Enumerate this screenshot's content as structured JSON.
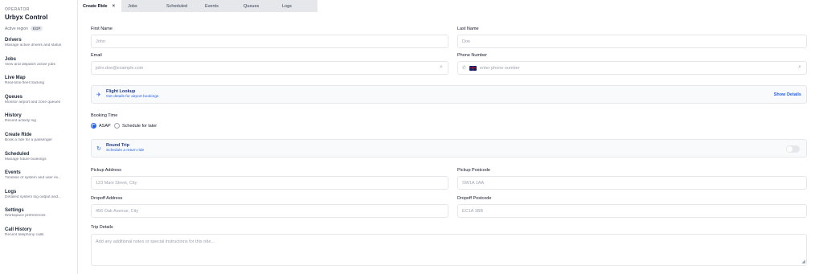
{
  "sidebar": {
    "operator_label": "OPERATOR",
    "app_title": "Urbyx Control",
    "region_label": "Active region",
    "region_badge": "EGP",
    "items": [
      {
        "title": "Drivers",
        "desc": "Manage active drivers and status"
      },
      {
        "title": "Jobs",
        "desc": "View and dispatch active jobs"
      },
      {
        "title": "Live Map",
        "desc": "Real-time fleet tracking"
      },
      {
        "title": "Queues",
        "desc": "Monitor airport and zone queues"
      },
      {
        "title": "History",
        "desc": "Recent activity log"
      },
      {
        "title": "Create Ride",
        "desc": "Book a ride for a passenger"
      },
      {
        "title": "Scheduled",
        "desc": "Manage future bookings"
      },
      {
        "title": "Events",
        "desc": "Timeline of system and user ev..."
      },
      {
        "title": "Logs",
        "desc": "Detailed system log output and..."
      },
      {
        "title": "Settings",
        "desc": "Workspace preferences"
      },
      {
        "title": "Call History",
        "desc": "Recent telephony calls"
      }
    ]
  },
  "tabs": {
    "active": "Create Ride",
    "close": "×",
    "others": [
      "Jobs",
      "Scheduled",
      "Events",
      "Queues",
      "Logs"
    ]
  },
  "form": {
    "first_name": {
      "label": "First Name",
      "placeholder": "John"
    },
    "last_name": {
      "label": "Last Name",
      "placeholder": "Doe"
    },
    "email": {
      "label": "Email",
      "placeholder": "john.doe@example.com"
    },
    "phone": {
      "label": "Phone Number",
      "placeholder": "enter phone number"
    },
    "flight": {
      "title": "Flight Lookup",
      "subtitle": "Get details for airport bookings",
      "action": "Show Details"
    },
    "booking_time": {
      "label": "Booking Time",
      "option_asap": "ASAP",
      "option_later": "Schedule for later",
      "selected": "ASAP"
    },
    "round_trip": {
      "title": "Round Trip",
      "subtitle": "Schedule a return ride",
      "enabled": false
    },
    "pickup_address": {
      "label": "Pickup Address",
      "placeholder": "123 Main Street, City"
    },
    "pickup_postcode": {
      "label": "Pickup Postcode",
      "placeholder": "SW1A 1AA"
    },
    "dropoff_address": {
      "label": "Dropoff Address",
      "placeholder": "456 Oak Avenue, City"
    },
    "dropoff_postcode": {
      "label": "Dropoff Postcode",
      "placeholder": "EC1A 1BB"
    },
    "trip_details": {
      "label": "Trip Details",
      "placeholder": "Add any additional notes or special instructions for this ride..."
    }
  },
  "colors": {
    "accent": "#2563eb",
    "tab_bar": "#e5e7eb",
    "border": "#e5e7eb"
  },
  "icons": {
    "search": "search-icon",
    "phone": "phone-icon",
    "plane": "plane-icon",
    "refresh": "refresh-icon",
    "flag": "uk-flag-icon"
  }
}
